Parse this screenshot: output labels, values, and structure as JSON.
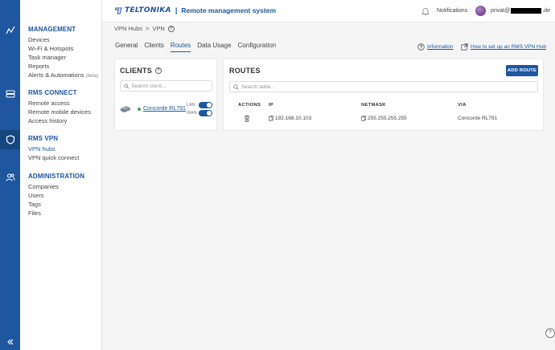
{
  "header": {
    "brand": "TELTONIKA",
    "separator": "|",
    "app_title": "Remote management system",
    "notifications": "Notifications",
    "user_prefix": "privat@",
    "user_suffix": ".de"
  },
  "menu": {
    "sections": [
      {
        "title": "MANAGEMENT",
        "items": [
          "Devices",
          "Wi-Fi & Hotspots",
          "Task manager",
          "Reports",
          "Alerts & Automations"
        ],
        "beta": "(beta)"
      },
      {
        "title": "RMS CONNECT",
        "items": [
          "Remote access",
          "Remote mobile devices",
          "Access history"
        ]
      },
      {
        "title": "RMS VPN",
        "items": [
          "VPN hubs",
          "VPN quick connect"
        ]
      },
      {
        "title": "ADMINISTRATION",
        "items": [
          "Companies",
          "Users",
          "Tags",
          "Files"
        ]
      }
    ]
  },
  "breadcrumb": {
    "first": "VPN Hubs",
    "sep": ">",
    "second": "VPN"
  },
  "tabs": [
    "General",
    "Clients",
    "Routes",
    "Data Usage",
    "Configuration"
  ],
  "links": {
    "information": "Information",
    "howto": "How to set up an RMS VPN Hub"
  },
  "clients_card": {
    "title": "CLIENTS",
    "search_placeholder": "Search client...",
    "client": {
      "name": "Concorde RL791",
      "lan": "LAN",
      "wan": "WAN"
    }
  },
  "routes_card": {
    "title": "ROUTES",
    "add_button": "ADD ROUTE",
    "search_placeholder": "Search table...",
    "columns": [
      "ACTIONS",
      "IP",
      "NETMASK",
      "VIA"
    ],
    "row": {
      "ip": "192.168.10.103",
      "netmask": "255.255.255.255",
      "via": "Concorde RL791"
    }
  },
  "help": "?",
  "colors": {
    "primary": "#1e56a0",
    "online": "#3aa757"
  }
}
